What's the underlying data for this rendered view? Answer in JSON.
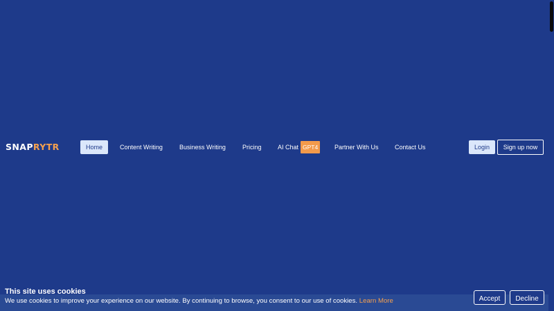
{
  "brand": {
    "logo_part1": "SNAP",
    "logo_part2": "RYTR",
    "accent_color": "#f5a04e",
    "background_color": "#1e3a8a"
  },
  "nav": {
    "items": [
      {
        "label": "Home",
        "active": true
      },
      {
        "label": "Content Writing"
      },
      {
        "label": "Business Writing"
      },
      {
        "label": "Pricing"
      },
      {
        "label": "AI Chat",
        "badge": "GPT4"
      },
      {
        "label": "Partner With Us"
      },
      {
        "label": "Contact Us"
      }
    ],
    "login_label": "Login",
    "signup_label": "Sign up now"
  },
  "cookie_banner": {
    "title": "This site uses cookies",
    "message": "We use cookies to improve your experience on our website. By continuing to browse, you consent to our use of cookies.",
    "link_label": "Learn More",
    "accept_label": "Accept",
    "decline_label": "Decline"
  }
}
